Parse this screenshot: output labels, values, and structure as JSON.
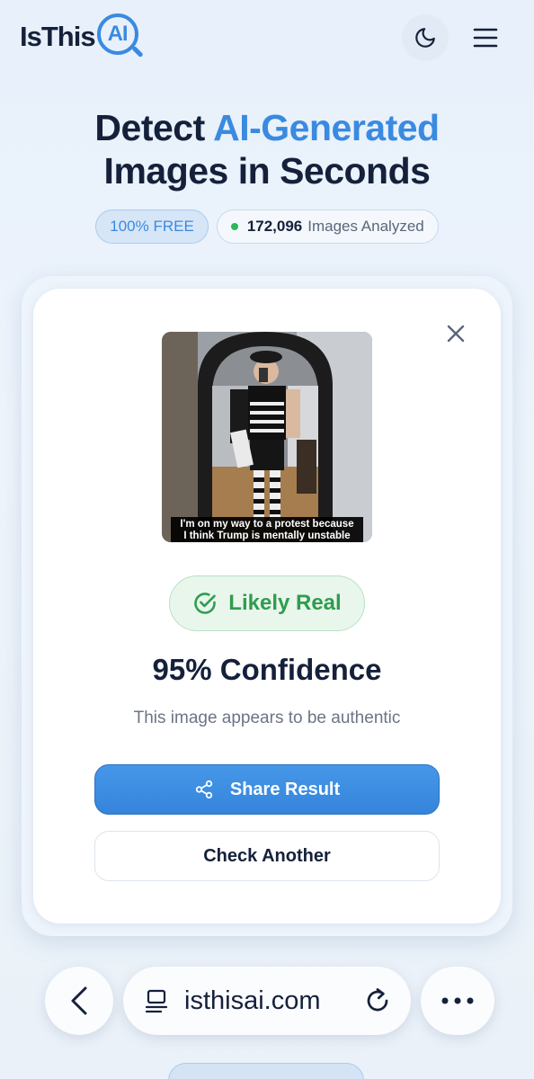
{
  "header": {
    "logo_text": "IsThis",
    "logo_badge": "AI",
    "theme_icon": "moon-icon",
    "menu_icon": "hamburger-menu-icon"
  },
  "hero": {
    "title_part1": "Detect ",
    "title_accent": "AI-Generated",
    "title_line2": "Images in Seconds"
  },
  "badges": {
    "free_label": "100% FREE",
    "count_value": "172,096",
    "count_label": "Images Analyzed"
  },
  "result": {
    "image_caption_line1": "I'm on my way to a protest because",
    "image_caption_line2": "I think Trump is mentally unstable",
    "verdict": "Likely Real",
    "confidence": "95% Confidence",
    "description": "This image appears to be authentic",
    "share_label": "Share Result",
    "check_another_label": "Check Another"
  },
  "browser": {
    "url": "isthisai.com"
  },
  "colors": {
    "accent": "#3a8ae0",
    "success": "#2f9d4d",
    "dark": "#15213a"
  }
}
